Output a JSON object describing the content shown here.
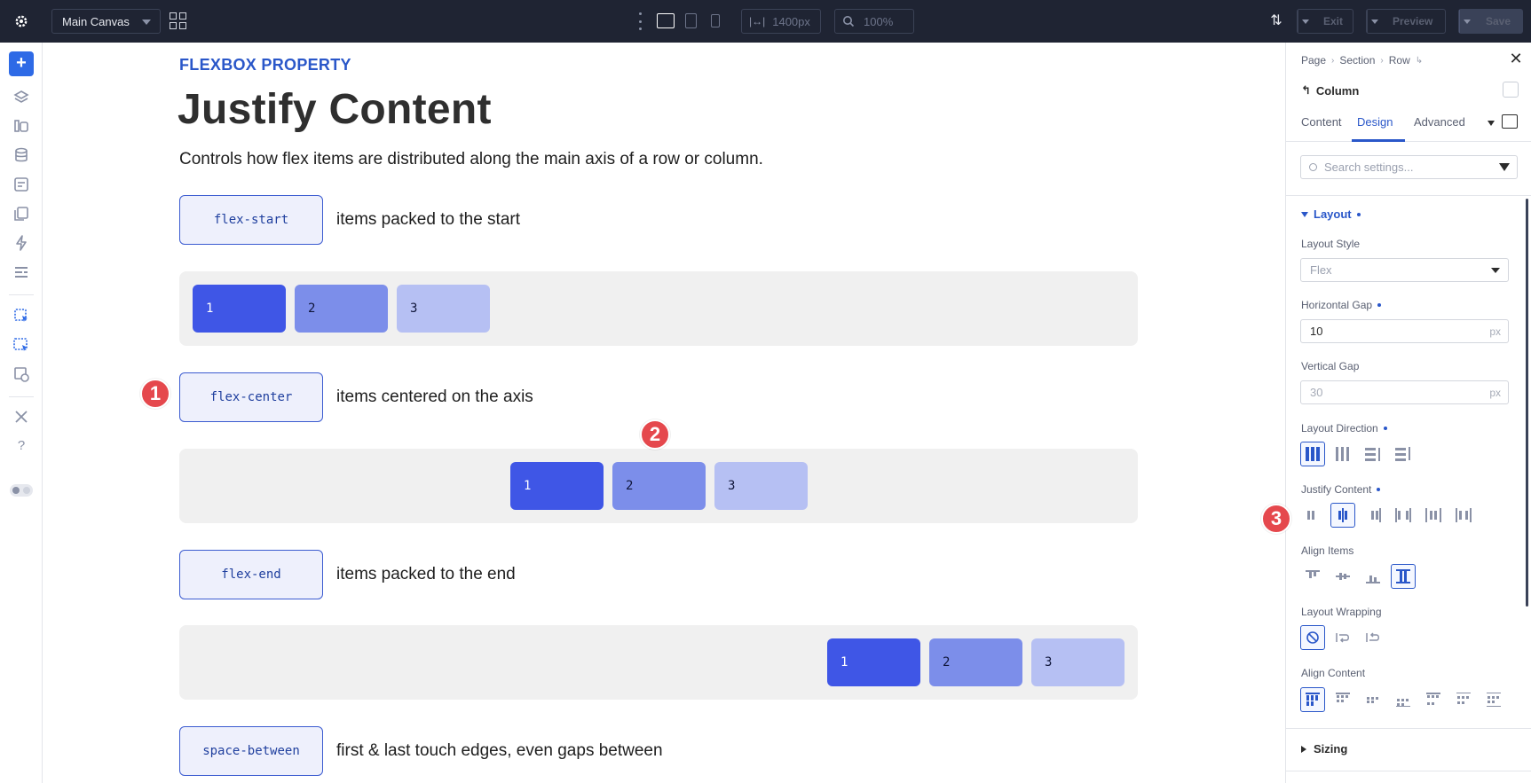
{
  "topbar": {
    "canvas_select": "Main Canvas",
    "width_value": "1400px",
    "zoom_value": "100%",
    "exit_label": "Exit",
    "preview_label": "Preview",
    "save_label": "Save"
  },
  "canvas": {
    "eyebrow": "FLEXBOX PROPERTY",
    "title": "Justify Content",
    "lead": "Controls how flex items are distributed along the main axis of a row or column.",
    "examples": [
      {
        "tag": "flex-start",
        "desc": "items packed to the start",
        "items": [
          "1",
          "2",
          "3"
        ]
      },
      {
        "tag": "flex-center",
        "desc": "items centered on the axis",
        "items": [
          "1",
          "2",
          "3"
        ]
      },
      {
        "tag": "flex-end",
        "desc": "items packed to the end",
        "items": [
          "1",
          "2",
          "3"
        ]
      },
      {
        "tag": "space-between",
        "desc": "first & last touch edges, even gaps between"
      }
    ],
    "badges": [
      "1",
      "2",
      "3"
    ]
  },
  "panel": {
    "breadcrumb": [
      "Page",
      "Section",
      "Row"
    ],
    "element_title": "Column",
    "tabs": [
      "Content",
      "Design",
      "Advanced"
    ],
    "active_tab": "Design",
    "search_placeholder": "Search settings...",
    "section_layout": "Layout",
    "layout_style_label": "Layout Style",
    "layout_style_value": "Flex",
    "hgap_label": "Horizontal Gap",
    "hgap_value": "10",
    "vgap_label": "Vertical Gap",
    "vgap_value": "30",
    "unit": "px",
    "direction_label": "Layout Direction",
    "justify_label": "Justify Content",
    "align_items_label": "Align Items",
    "wrapping_label": "Layout Wrapping",
    "align_content_label": "Align Content",
    "section_sizing": "Sizing"
  },
  "colors": {
    "accent": "#2a57c9",
    "topbar_bg": "#1f2433",
    "badge": "#e5484d",
    "item1": "#3f56e6",
    "item2": "#7c8eea",
    "item3": "#b6c0f3"
  }
}
